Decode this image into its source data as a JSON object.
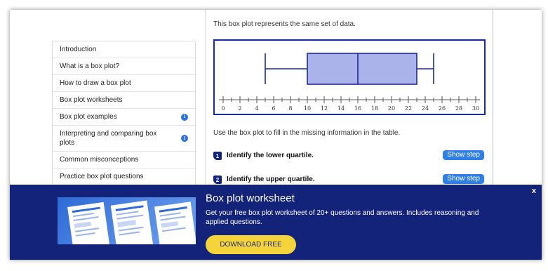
{
  "sidebar": {
    "items": [
      {
        "label": "Introduction",
        "info": false
      },
      {
        "label": "What is a box plot?",
        "info": false
      },
      {
        "label": "How to draw a box plot",
        "info": false
      },
      {
        "label": "Box plot worksheets",
        "info": false
      },
      {
        "label": "Box plot examples",
        "info": true
      },
      {
        "label": "Interpreting and comparing box plots",
        "info": true
      },
      {
        "label": "Common misconceptions",
        "info": false
      },
      {
        "label": "Practice box plot questions",
        "info": false
      }
    ],
    "info_glyph": "i"
  },
  "main": {
    "intro_text": "This box plot represents the same set of data.",
    "instruction_text": "Use the box plot to fill in the missing information in the table.",
    "questions": [
      {
        "number": "1",
        "text": "Identify the lower quartile.",
        "button": "Show step"
      },
      {
        "number": "2",
        "text": "Identify the upper quartile.",
        "button": "Show step"
      }
    ]
  },
  "chart_data": {
    "type": "box",
    "axis": {
      "min": 0,
      "max": 30,
      "tick_labels": [
        "0",
        "2",
        "4",
        "6",
        "8",
        "10",
        "12",
        "14",
        "16",
        "18",
        "20",
        "22",
        "24",
        "26",
        "28",
        "30"
      ],
      "minor_step": 1
    },
    "box": {
      "min": 5,
      "q1": 10,
      "median": 16,
      "q3": 23,
      "max": 25
    },
    "colors": {
      "box_fill": "#aab3ea",
      "box_stroke": "#1a2a9e",
      "frame": "#1a2a9e"
    }
  },
  "banner": {
    "title": "Box plot worksheet",
    "description": "Get your free box plot worksheet of 20+ questions and answers. Includes reasoning and applied questions.",
    "button_label": "DOWNLOAD FREE",
    "close_label": "x",
    "colors": {
      "background": "#13237a",
      "button": "#f5d33a"
    }
  }
}
